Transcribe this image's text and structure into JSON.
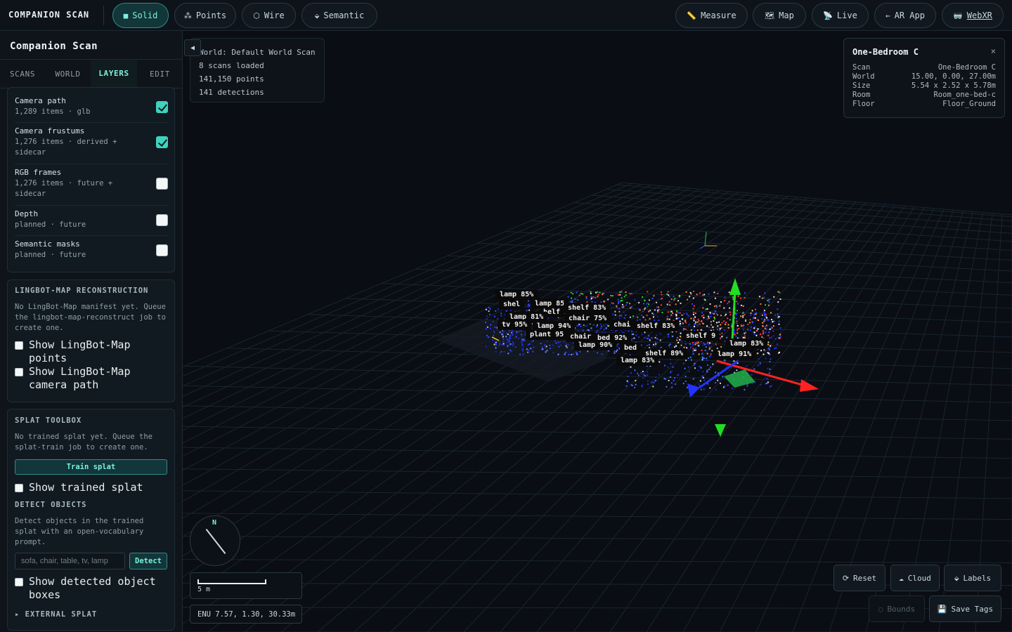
{
  "app": {
    "title": "COMPANION SCAN"
  },
  "topbar": {
    "modes": [
      {
        "label": "Solid",
        "icon": "■",
        "icon_name": "solid-square-icon",
        "active": true
      },
      {
        "label": "Points",
        "icon": "⁂",
        "icon_name": "points-icon",
        "active": false
      },
      {
        "label": "Wire",
        "icon": "⬡",
        "icon_name": "wire-hexagon-icon",
        "active": false
      },
      {
        "label": "Semantic",
        "icon": "⬙",
        "icon_name": "tag-icon",
        "active": false
      }
    ],
    "tools": [
      {
        "label": "Measure",
        "icon": "📏",
        "icon_name": "ruler-icon"
      },
      {
        "label": "Map",
        "icon": "🗺",
        "icon_name": "map-icon"
      },
      {
        "label": "Live",
        "icon": "📡",
        "icon_name": "satellite-icon"
      },
      {
        "label": "AR App",
        "icon": "←",
        "icon_name": "arrow-left-icon"
      },
      {
        "label": "WebXR",
        "icon": "🥽",
        "icon_name": "vr-headset-icon"
      }
    ]
  },
  "sidebar": {
    "title": "Companion Scan",
    "tabs": [
      {
        "label": "SCANS",
        "active": false
      },
      {
        "label": "WORLD",
        "active": false
      },
      {
        "label": "LAYERS",
        "active": true
      },
      {
        "label": "EDIT",
        "active": false
      }
    ],
    "layers": [
      {
        "name": "Camera path",
        "meta": "1,289 items · glb",
        "checked": true
      },
      {
        "name": "Camera frustums",
        "meta": "1,276 items · derived + sidecar",
        "checked": true
      },
      {
        "name": "RGB frames",
        "meta": "1,276 items · future + sidecar",
        "checked": false
      },
      {
        "name": "Depth",
        "meta": "planned · future",
        "checked": false
      },
      {
        "name": "Semantic masks",
        "meta": "planned · future",
        "checked": false
      }
    ],
    "lingbot": {
      "heading": "LINGBOT-MAP RECONSTRUCTION",
      "text": "No LingBot-Map manifest yet. Queue the lingbot-map-reconstruct job to create one.",
      "options": [
        "Show LingBot-Map points",
        "Show LingBot-Map camera path"
      ]
    },
    "splat": {
      "heading": "SPLAT TOOLBOX",
      "text": "No trained splat yet. Queue the splat-train job to create one.",
      "train_label": "Train splat",
      "show_label": "Show trained splat",
      "detect_heading": "DETECT OBJECTS",
      "detect_text": "Detect objects in the trained splat with an open-vocabulary prompt.",
      "prompt_placeholder": "sofa, chair, table, tv, lamp",
      "detect_label": "Detect",
      "show_boxes_label": "Show detected object boxes",
      "external_label": "▸ EXTERNAL SPLAT"
    }
  },
  "viewport": {
    "collapse": "◀",
    "info": [
      "World: Default World Scan",
      "8 scans loaded",
      "141,150 points",
      "141 detections"
    ],
    "scan_card": {
      "title": "One-Bedroom C",
      "close": "×",
      "rows": [
        {
          "k": "Scan",
          "v": "One-Bedroom C"
        },
        {
          "k": "World",
          "v": "15.00, 0.00, 27.00m"
        },
        {
          "k": "Size",
          "v": "5.54 x 2.52 x 5.78m"
        },
        {
          "k": "Room",
          "v": "Room_one-bed-c"
        },
        {
          "k": "Floor",
          "v": "Floor_Ground"
        }
      ]
    },
    "compass": {
      "n": "N"
    },
    "scale": "5 m",
    "enu": "ENU 7.57, 1.30, 30.33m",
    "buttons": [
      {
        "label": "Reset",
        "icon": "⟳",
        "icon_name": "reset-icon",
        "enabled": true
      },
      {
        "label": "Cloud",
        "icon": "☁",
        "icon_name": "cloud-icon",
        "enabled": true
      },
      {
        "label": "Labels",
        "icon": "⬙",
        "icon_name": "tag-icon",
        "enabled": true
      },
      {
        "label": "Bounds",
        "icon": "◌",
        "icon_name": "bounds-icon",
        "enabled": false
      },
      {
        "label": "Save Tags",
        "icon": "💾",
        "icon_name": "save-icon",
        "enabled": true
      }
    ],
    "labels": [
      "lamp 85%",
      "shel",
      "lamp 85",
      "helf",
      "lamp 81%",
      "shelf 83%",
      "chair 75%",
      "tv 95%",
      "lamp 94%",
      "chai",
      "shelf 83%",
      "plant 95",
      "chair",
      "bed 92%",
      "lamp 90%",
      "shelf 9",
      "lamp 83%",
      "bed",
      "shelf 89%",
      "lamp 91%",
      "lamp 83%"
    ]
  }
}
